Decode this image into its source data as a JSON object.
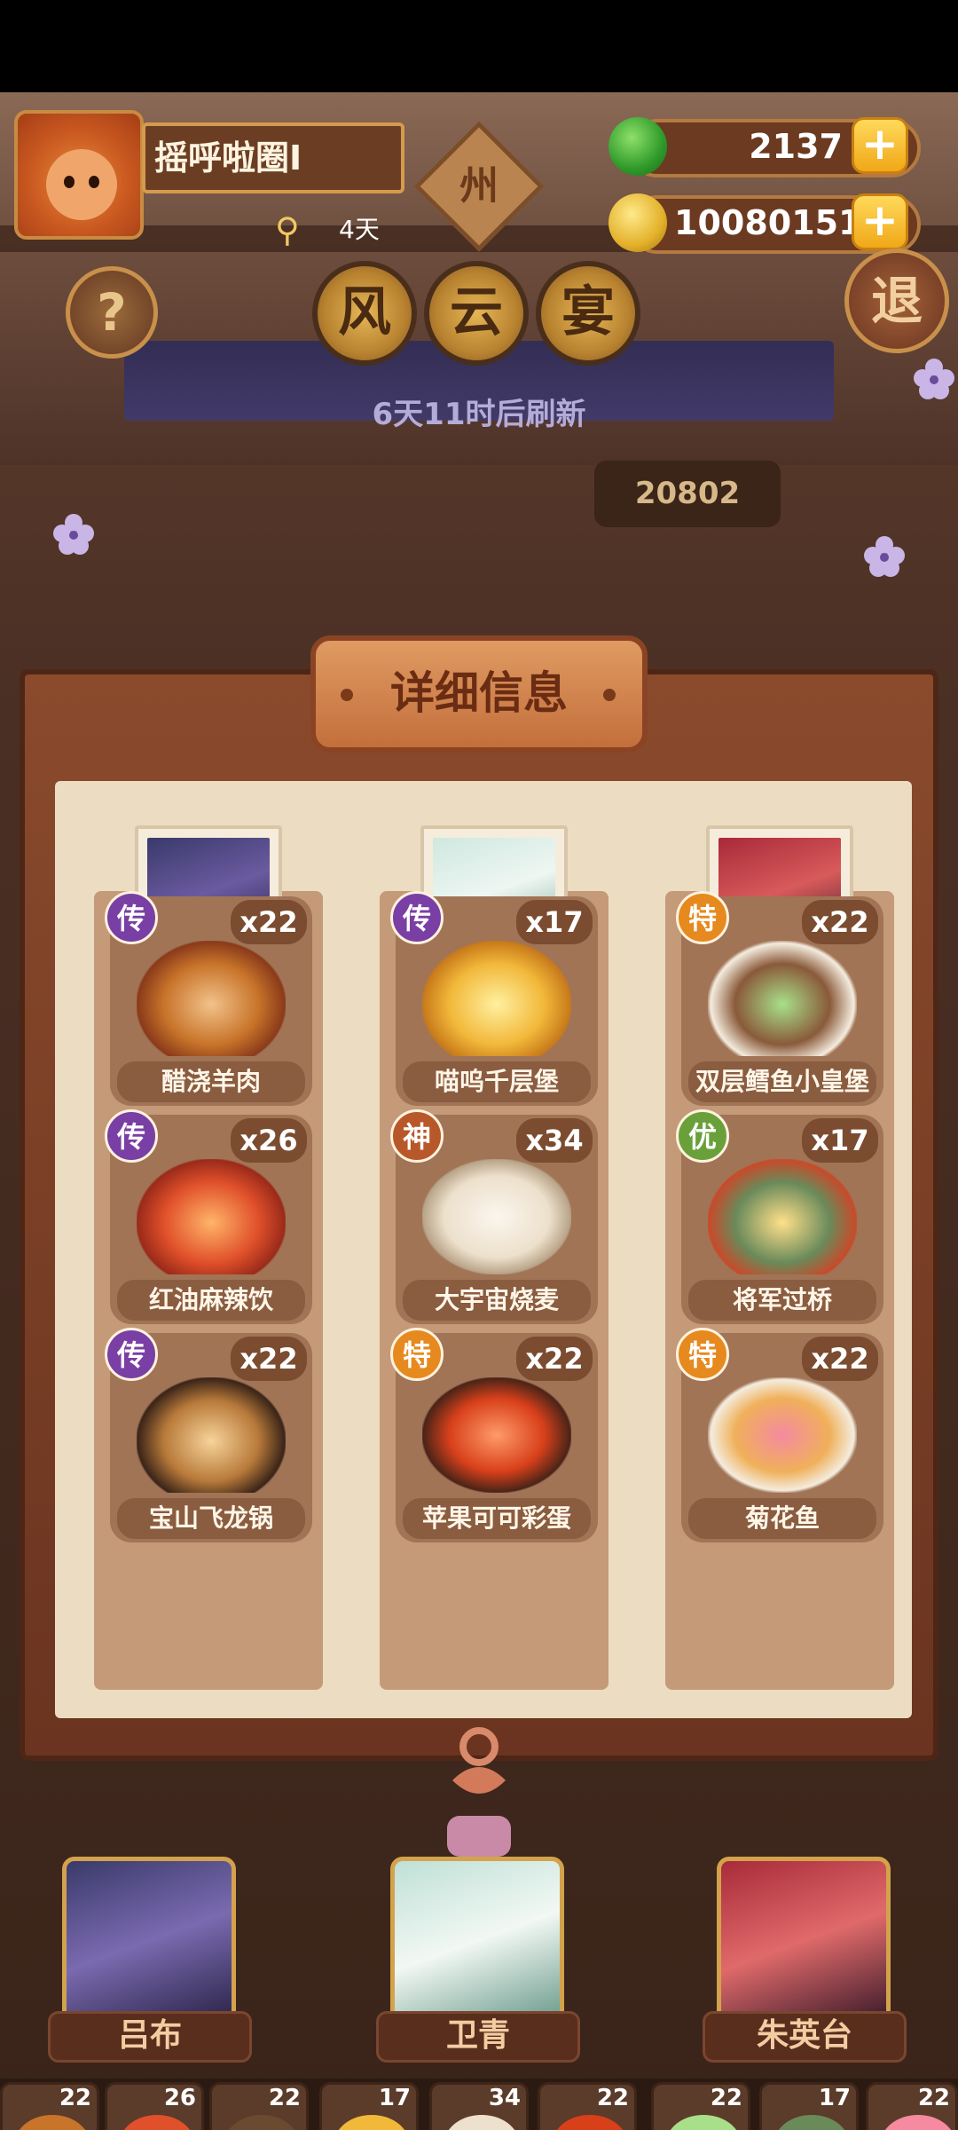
{
  "player": {
    "name": "摇呼啦圈I",
    "days": "4天"
  },
  "sign": "州",
  "currency": {
    "jade": "2137",
    "coins": "10080151",
    "plus": "+"
  },
  "buttons": {
    "help": "?",
    "exit": "退"
  },
  "event_title": [
    "风",
    "云",
    "宴"
  ],
  "refresh_text": "6天11时后刷新",
  "bg_score": "20802",
  "panel_title": "详细信息",
  "colors": {
    "rank_chuan": "#7a3fa4",
    "rank_shen": "#b8582a",
    "rank_te": "#e6891e",
    "rank_you": "#6aa03a"
  },
  "columns": [
    {
      "hero": "吕布",
      "dishes": [
        {
          "name": "醋浇羊肉",
          "rank": "传",
          "count": "x22"
        },
        {
          "name": "红油麻辣饮",
          "rank": "传",
          "count": "x26"
        },
        {
          "name": "宝山飞龙锅",
          "rank": "传",
          "count": "x22"
        }
      ]
    },
    {
      "hero": "卫青",
      "dishes": [
        {
          "name": "喵呜千层堡",
          "rank": "传",
          "count": "x17"
        },
        {
          "name": "大宇宙烧麦",
          "rank": "神",
          "count": "x34"
        },
        {
          "name": "苹果可可彩蛋",
          "rank": "特",
          "count": "x22"
        }
      ]
    },
    {
      "hero": "朱英台",
      "dishes": [
        {
          "name": "双层鳕鱼小皇堡",
          "rank": "特",
          "count": "x22"
        },
        {
          "name": "将军过桥",
          "rank": "优",
          "count": "x17"
        },
        {
          "name": "菊花鱼",
          "rank": "特",
          "count": "x22"
        }
      ]
    }
  ],
  "tray": [
    "22",
    "26",
    "22",
    "17",
    "34",
    "22",
    "22",
    "17",
    "22"
  ]
}
